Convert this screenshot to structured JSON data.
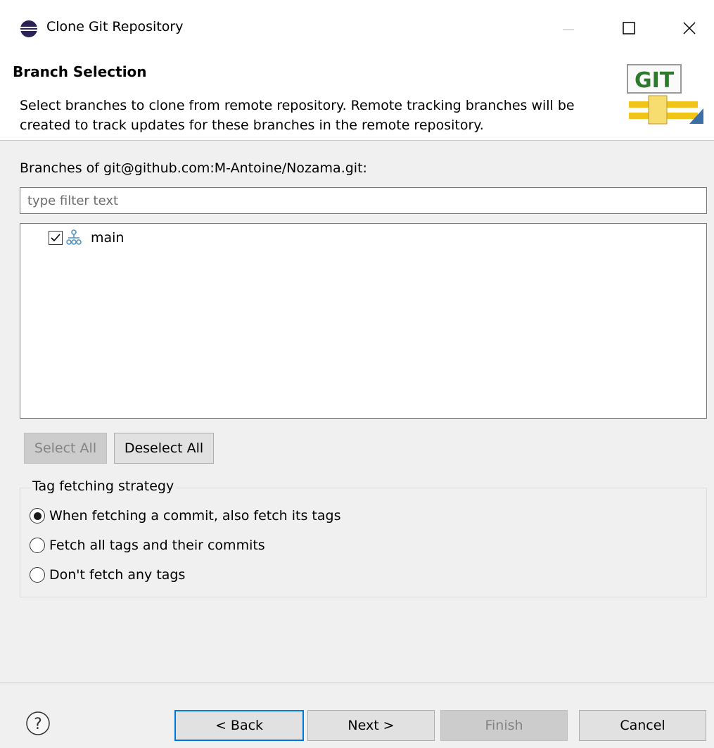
{
  "window": {
    "title": "Clone Git Repository"
  },
  "banner": {
    "title": "Branch Selection",
    "description": "Select branches to clone from remote repository. Remote tracking branches will be created to track updates for these branches in the remote repository.",
    "logo_text": "GIT"
  },
  "branches": {
    "label": "Branches of git@github.com:M-Antoine/Nozama.git:",
    "filter_placeholder": "type filter text",
    "items": [
      {
        "name": "main",
        "checked": true
      }
    ],
    "select_all_label": "Select All",
    "deselect_all_label": "Deselect All"
  },
  "tag_strategy": {
    "legend": "Tag fetching strategy",
    "options": [
      {
        "label": "When fetching a commit, also fetch its tags",
        "selected": true
      },
      {
        "label": "Fetch all tags and their commits",
        "selected": false
      },
      {
        "label": "Don't fetch any tags",
        "selected": false
      }
    ]
  },
  "footer": {
    "help_icon": "help-icon",
    "back_label": "< Back",
    "next_label": "Next >",
    "finish_label": "Finish",
    "cancel_label": "Cancel"
  },
  "colors": {
    "accent": "#0078d7",
    "background": "#f0f0f0",
    "git_red": "#d42a20",
    "git_green": "#2d7a2d",
    "pipe_yellow": "#f0c419"
  }
}
